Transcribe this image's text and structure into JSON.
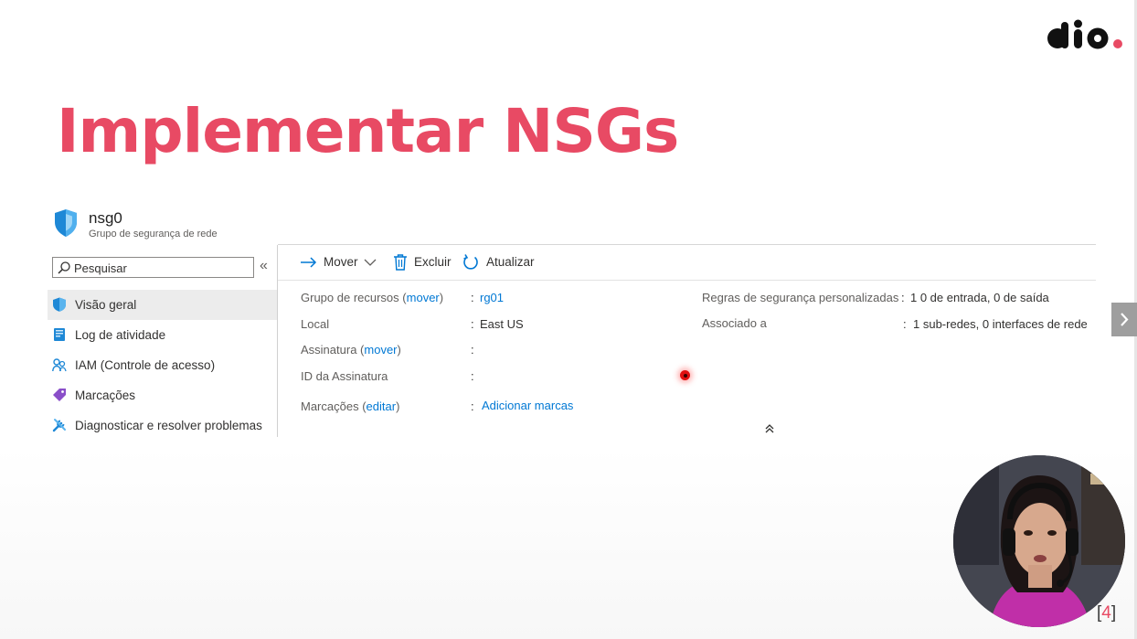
{
  "slide": {
    "title": "Implementar NSGs",
    "title_color": "#e84a64",
    "page_bracket_open": "[",
    "page_number": "4",
    "page_bracket_close": "]"
  },
  "brand": {
    "logo_icon": "dio-logo",
    "accent": "#e84a64"
  },
  "resource": {
    "name": "nsg0",
    "type": "Grupo de segurança de rede",
    "icon": "shield-icon"
  },
  "sidebar": {
    "search_placeholder": "Pesquisar",
    "collapse_label": "«",
    "items": [
      {
        "label": "Visão geral",
        "icon": "shield-icon",
        "active": true
      },
      {
        "label": "Log de atividade",
        "icon": "activity-log-icon"
      },
      {
        "label": "IAM (Controle de acesso)",
        "icon": "people-icon"
      },
      {
        "label": "Marcações",
        "icon": "tag-icon"
      },
      {
        "label": "Diagnosticar e resolver  problemas",
        "icon": "wrench-icon"
      }
    ]
  },
  "toolbar": {
    "move_label": "Mover",
    "delete_label": "Excluir",
    "refresh_label": "Atualizar"
  },
  "essentials": {
    "left": [
      {
        "label": "Grupo de recursos",
        "link": "mover",
        "value": "rg01",
        "value_is_link": true
      },
      {
        "label": "Local",
        "link": "",
        "value": "East US",
        "value_is_link": false
      },
      {
        "label": "Assinatura",
        "link": "mover",
        "value": "",
        "value_is_link": false
      },
      {
        "label": "ID da Assinatura",
        "link": "",
        "value": "",
        "value_is_link": false
      },
      {
        "label": "Marcações",
        "link": "editar",
        "value": "Adicionar marcas",
        "value_is_link": true
      }
    ],
    "right": [
      {
        "label": "Regras de segurança personalizadas",
        "value": "1 0 de entrada, 0 de saída"
      },
      {
        "label": "Associado a",
        "value": "1 sub-redes, 0 interfaces de rede"
      }
    ],
    "colon": ":",
    "paren_open": "(",
    "paren_close": ")"
  }
}
